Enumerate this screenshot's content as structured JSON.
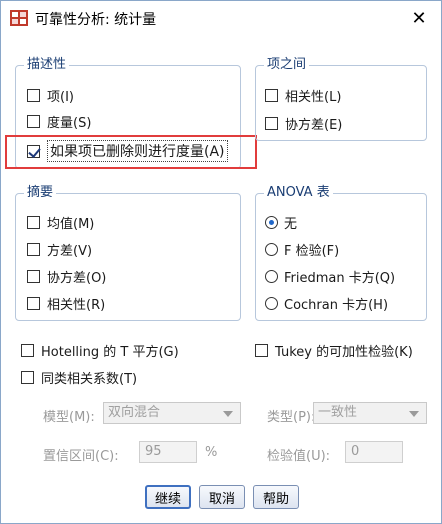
{
  "window": {
    "title": "可靠性分析: 统计量"
  },
  "groups": {
    "descriptive": {
      "title": "描述性",
      "items": [
        {
          "label": "项(I)",
          "checked": false
        },
        {
          "label": "度量(S)",
          "checked": false
        },
        {
          "label": "如果项已删除则进行度量(A)",
          "checked": true
        }
      ]
    },
    "inter_item": {
      "title": "项之间",
      "items": [
        {
          "label": "相关性(L)",
          "checked": false
        },
        {
          "label": "协方差(E)",
          "checked": false
        }
      ]
    },
    "summaries": {
      "title": "摘要",
      "items": [
        {
          "label": "均值(M)",
          "checked": false
        },
        {
          "label": "方差(V)",
          "checked": false
        },
        {
          "label": "协方差(O)",
          "checked": false
        },
        {
          "label": "相关性(R)",
          "checked": false
        }
      ]
    },
    "anova": {
      "title": "ANOVA 表",
      "items": [
        {
          "label": "无",
          "selected": true
        },
        {
          "label": "F 检验(F)",
          "selected": false
        },
        {
          "label": "Friedman 卡方(Q)",
          "selected": false
        },
        {
          "label": "Cochran 卡方(H)",
          "selected": false
        }
      ]
    }
  },
  "options": {
    "hotelling": {
      "label": "Hotelling 的 T 平方(G)",
      "checked": false
    },
    "tukey": {
      "label": "Tukey 的可加性检验(K)",
      "checked": false
    },
    "icc": {
      "label": "同类相关系数(T)",
      "checked": false
    }
  },
  "icc_settings": {
    "model_label": "模型(M):",
    "model_value": "双向混合",
    "type_label": "类型(P):",
    "type_value": "一致性",
    "ci_label": "置信区间(C):",
    "ci_value": "95",
    "ci_unit": "%",
    "test_label": "检验值(U):",
    "test_value": "0"
  },
  "buttons": {
    "continue": "继续",
    "cancel": "取消",
    "help": "帮助"
  },
  "colors": {
    "group_title": "#1a3d73",
    "highlight_box": "#e13c3c",
    "radio_selected": "#1f66c8"
  }
}
